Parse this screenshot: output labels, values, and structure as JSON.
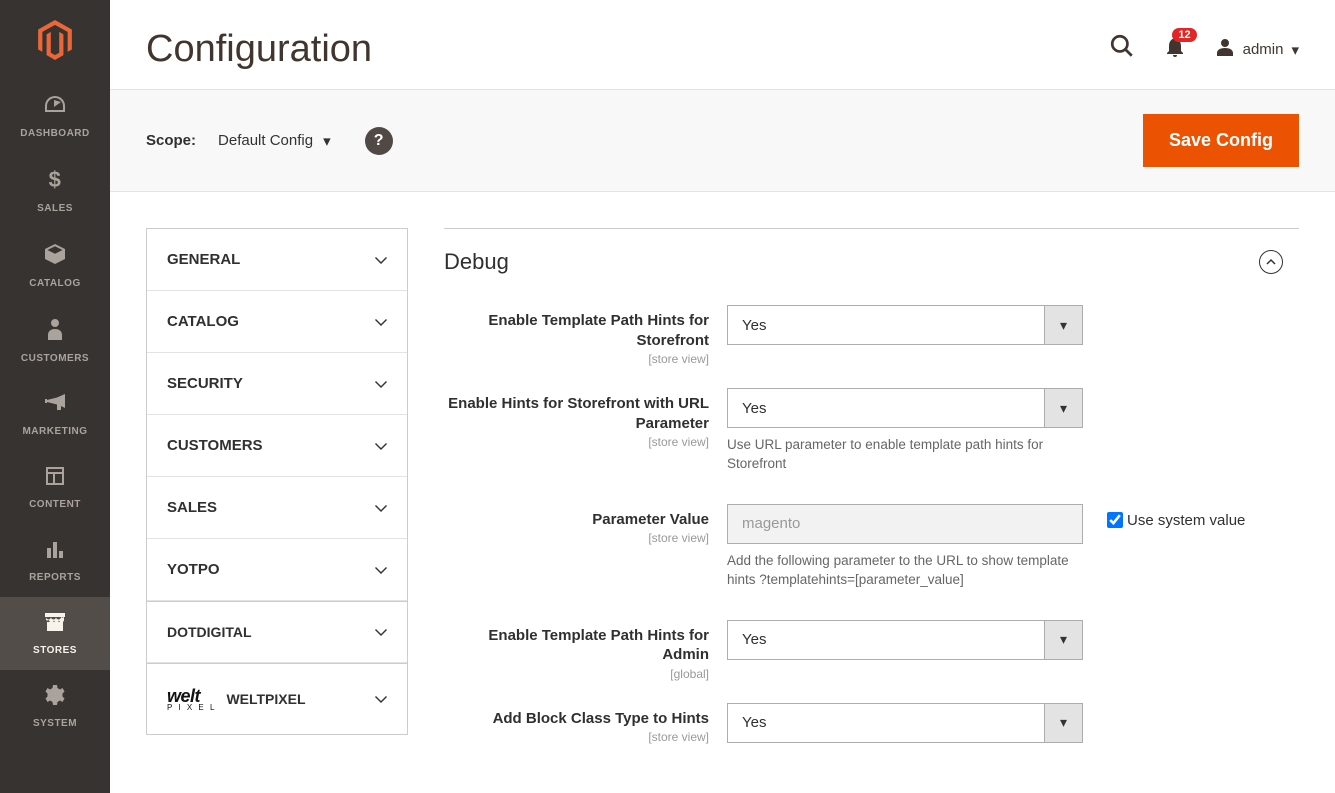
{
  "sidebar": {
    "items": [
      {
        "label": "DASHBOARD"
      },
      {
        "label": "SALES"
      },
      {
        "label": "CATALOG"
      },
      {
        "label": "CUSTOMERS"
      },
      {
        "label": "MARKETING"
      },
      {
        "label": "CONTENT"
      },
      {
        "label": "REPORTS"
      },
      {
        "label": "STORES"
      },
      {
        "label": "SYSTEM"
      }
    ]
  },
  "header": {
    "title": "Configuration",
    "notifications": "12",
    "user": "admin"
  },
  "scope": {
    "label": "Scope:",
    "value": "Default Config",
    "save_btn": "Save Config"
  },
  "config_nav": [
    {
      "label": "GENERAL"
    },
    {
      "label": "CATALOG"
    },
    {
      "label": "SECURITY"
    },
    {
      "label": "CUSTOMERS"
    },
    {
      "label": "SALES"
    },
    {
      "label": "YOTPO"
    },
    {
      "label": "DOTDIGITAL"
    },
    {
      "label": "WELTPIXEL"
    }
  ],
  "section": {
    "title": "Debug",
    "fields": [
      {
        "label": "Enable Template Path Hints for Storefront",
        "scope": "[store view]",
        "value": "Yes"
      },
      {
        "label": "Enable Hints for Storefront with URL Parameter",
        "scope": "[store view]",
        "value": "Yes",
        "note": "Use URL parameter to enable template path hints for Storefront"
      },
      {
        "label": "Parameter Value",
        "scope": "[store view]",
        "value": "magento",
        "note": "Add the following parameter to the URL to show template hints ?templatehints=[parameter_value]",
        "checkbox": "Use system value"
      },
      {
        "label": "Enable Template Path Hints for Admin",
        "scope": "[global]",
        "value": "Yes"
      },
      {
        "label": "Add Block Class Type to Hints",
        "scope": "[store view]",
        "value": "Yes"
      }
    ]
  }
}
